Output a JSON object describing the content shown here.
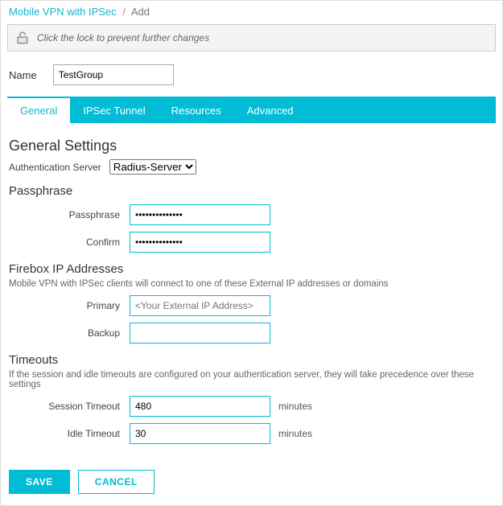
{
  "breadcrumb": {
    "parent": "Mobile VPN with IPSec",
    "current": "Add"
  },
  "lock_msg": "Click the lock to prevent further changes",
  "name": {
    "label": "Name",
    "value": "TestGroup"
  },
  "tabs": [
    "General",
    "IPSec Tunnel",
    "Resources",
    "Advanced"
  ],
  "active_tab": 0,
  "general": {
    "heading": "General Settings",
    "auth_server": {
      "label": "Authentication Server",
      "value": "Radius-Server"
    },
    "passphrase": {
      "heading": "Passphrase",
      "pass": {
        "label": "Passphrase",
        "value": "••••••••••••••"
      },
      "confirm": {
        "label": "Confirm",
        "value": "••••••••••••••"
      }
    },
    "firebox": {
      "heading": "Firebox IP Addresses",
      "helper": "Mobile VPN with IPSec clients will connect to one of these External IP addresses or domains",
      "primary": {
        "label": "Primary",
        "placeholder": "<Your External IP Address>"
      },
      "backup": {
        "label": "Backup",
        "value": ""
      }
    },
    "timeouts": {
      "heading": "Timeouts",
      "helper": "If the session and idle timeouts are configured on your authentication server, they will take precedence over these settings",
      "session": {
        "label": "Session Timeout",
        "value": "480",
        "unit": "minutes"
      },
      "idle": {
        "label": "Idle Timeout",
        "value": "30",
        "unit": "minutes"
      }
    }
  },
  "buttons": {
    "save": "SAVE",
    "cancel": "CANCEL"
  }
}
